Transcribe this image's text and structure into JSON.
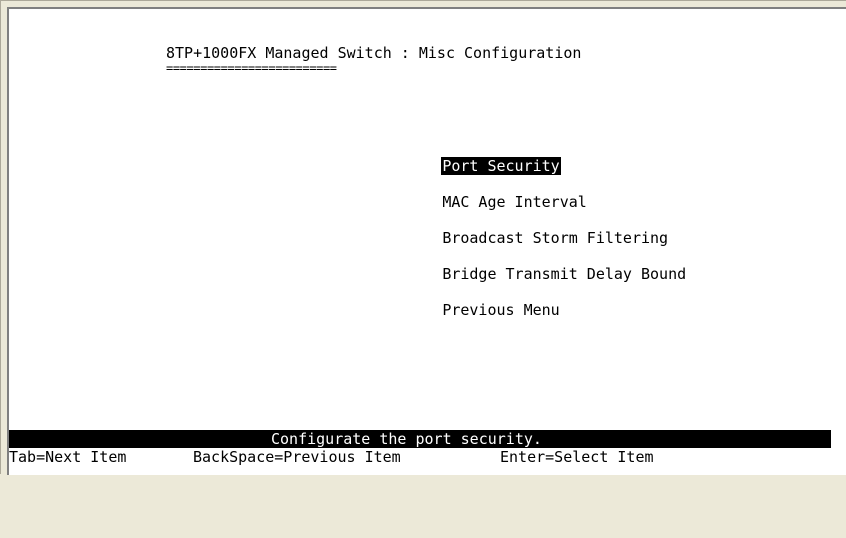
{
  "screen": {
    "title": "8TP+1000FX Managed Switch : Misc Configuration",
    "title_underline": "========================="
  },
  "menu": {
    "items": [
      {
        "label": "Port Security",
        "selected": true
      },
      {
        "label": "MAC Age Interval",
        "selected": false
      },
      {
        "label": "Broadcast Storm Filtering",
        "selected": false
      },
      {
        "label": "Bridge Transmit Delay Bound",
        "selected": false
      },
      {
        "label": "Previous Menu",
        "selected": false
      }
    ]
  },
  "status": {
    "message": "Configurate the port security."
  },
  "help": {
    "tab": "Tab=Next Item",
    "backspace": "BackSpace=Previous Item",
    "enter": "Enter=Select Item"
  },
  "colors": {
    "background": "#ffffff",
    "foreground": "#000000",
    "highlight_bg": "#000000",
    "highlight_fg": "#ffffff"
  }
}
